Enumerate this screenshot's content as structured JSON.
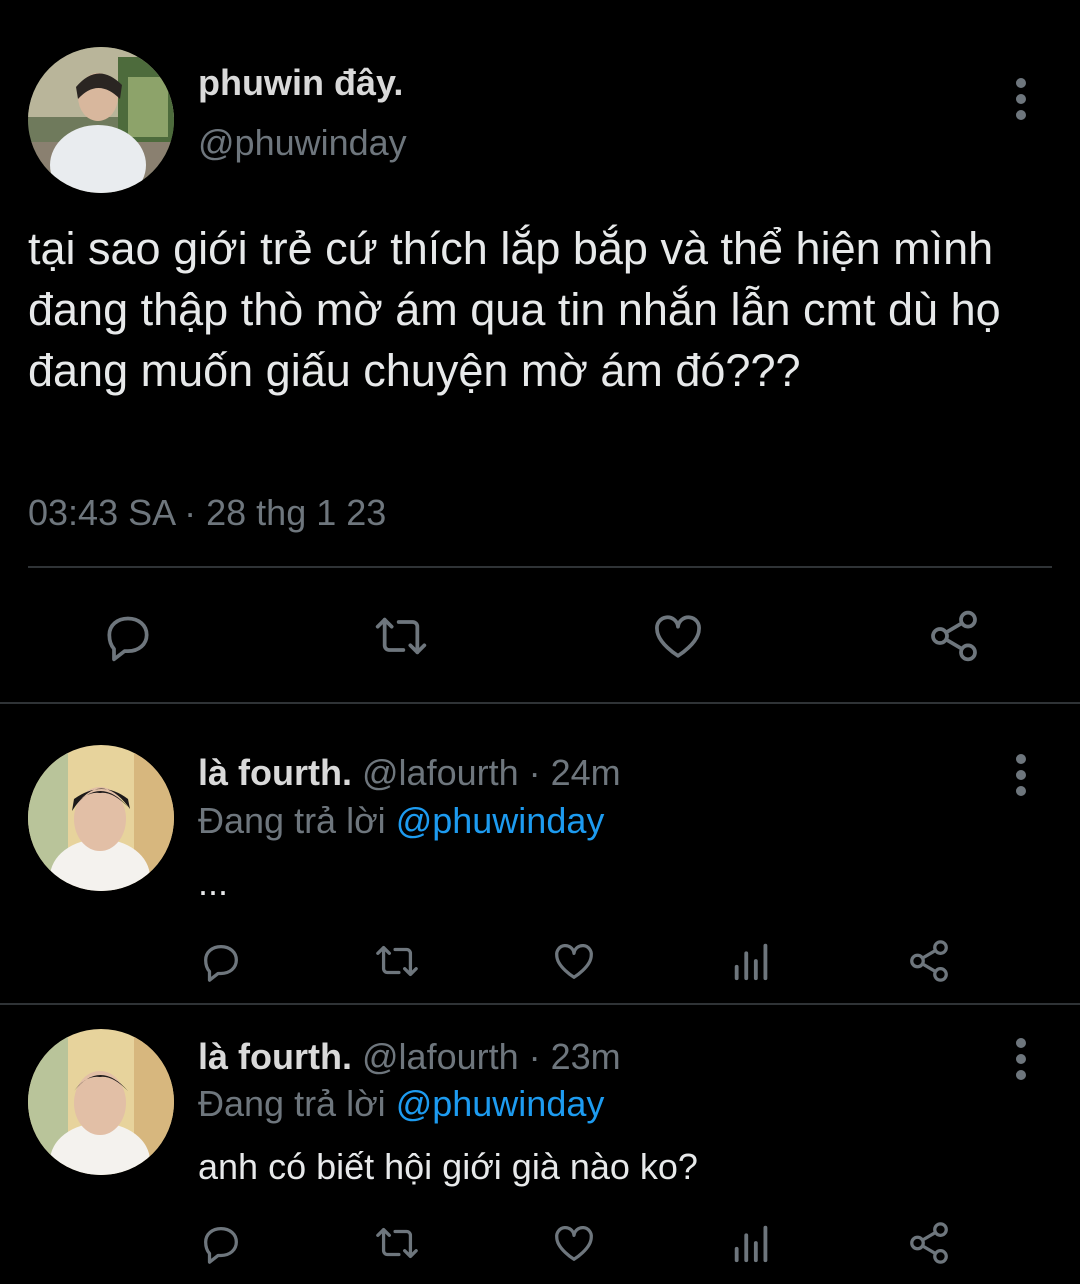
{
  "tweet": {
    "display_name": "phuwin đây.",
    "handle": "@phuwinday",
    "text": "tại sao giới trẻ cứ thích lắp bắp và thể hiện mình đang thập thò mờ ám qua tin nhắn lẫn cmt dù họ đang muốn giấu chuyện mờ ám đó???",
    "timestamp": "03:43 SA · 28 thg 1 23",
    "actions": [
      "reply-icon",
      "retweet-icon",
      "like-icon",
      "share-icon"
    ]
  },
  "replies": [
    {
      "display_name": "là fourth.",
      "handle": "@lafourth",
      "age": "· 24m",
      "replying_prefix": "Đang trả lời ",
      "replying_to": "@phuwinday",
      "text": "...",
      "actions": [
        "reply-icon",
        "retweet-icon",
        "like-icon",
        "views-icon",
        "share-icon"
      ]
    },
    {
      "display_name": "là fourth.",
      "handle": "@lafourth",
      "age": "· 23m",
      "replying_prefix": "Đang trả lời ",
      "replying_to": "@phuwinday",
      "text": "anh có biết hội giới già nào ko?",
      "actions": [
        "reply-icon",
        "retweet-icon",
        "like-icon",
        "views-icon",
        "share-icon"
      ]
    }
  ],
  "colors": {
    "background": "#000000",
    "text": "#d9d9d9",
    "muted": "#6e767d",
    "link": "#1d9bf0",
    "divider": "#2f3336"
  }
}
